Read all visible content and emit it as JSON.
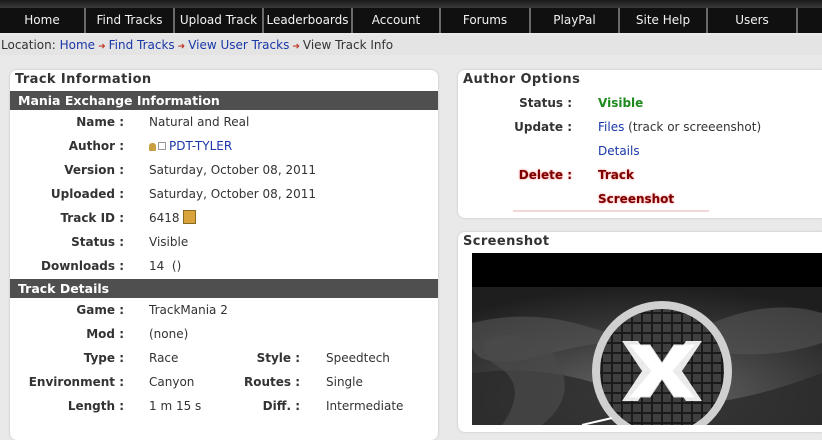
{
  "nav": {
    "items": [
      "Home",
      "Find Tracks",
      "Upload Track",
      "Leaderboards",
      "Account",
      "Forums",
      "PlayPal",
      "Site Help",
      "Users",
      ""
    ]
  },
  "breadcrumb": {
    "label": "Location:",
    "links": [
      "Home",
      "Find Tracks",
      "View User Tracks"
    ],
    "current": "View Track Info"
  },
  "track_info": {
    "title": "Track Information",
    "section1": "Mania Exchange Information",
    "name_label": "Name :",
    "name": "Natural and Real",
    "author_label": "Author :",
    "author": "PDT-TYLER",
    "version_label": "Version :",
    "version": "Saturday, October 08, 2011",
    "uploaded_label": "Uploaded :",
    "uploaded": "Saturday, October 08, 2011",
    "trackid_label": "Track ID :",
    "trackid": "6418",
    "status_label": "Status :",
    "status": "Visible",
    "downloads_label": "Downloads :",
    "downloads": "14  ()",
    "section2": "Track Details",
    "game_label": "Game :",
    "game": "TrackMania 2",
    "mod_label": "Mod :",
    "mod": "(none)",
    "type_label": "Type :",
    "type": "Race",
    "style_label": "Style :",
    "style": "Speedtech",
    "env_label": "Environment :",
    "env": "Canyon",
    "routes_label": "Routes :",
    "routes": "Single",
    "length_label": "Length :",
    "length": "1 m 15 s",
    "diff_label": "Diff. :",
    "diff": "Intermediate"
  },
  "author_options": {
    "title": "Author Options",
    "status_label": "Status :",
    "status": "Visible",
    "update_label": "Update :",
    "files_link": "Files",
    "files_note": " (track or screeenshot)",
    "details_link": "Details",
    "delete_label": "Delete :",
    "delete_track": "Track",
    "delete_screenshot": "Screenshot"
  },
  "screenshot": {
    "title": "Screenshot"
  },
  "colors": {
    "nav_bg": "#101010",
    "section_bar": "#4f4f4f",
    "link": "#1a37a8",
    "visible_green": "#1e8a1e",
    "delete_red": "#7a0000"
  }
}
